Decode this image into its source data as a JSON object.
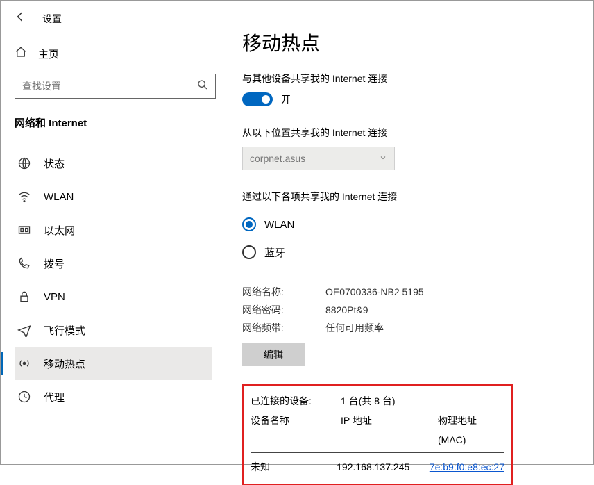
{
  "header": {
    "app_title": "设置"
  },
  "sidebar": {
    "home_label": "主页",
    "search_placeholder": "查找设置",
    "category_title": "网络和 Internet",
    "items": [
      {
        "label": "状态"
      },
      {
        "label": "WLAN"
      },
      {
        "label": "以太网"
      },
      {
        "label": "拨号"
      },
      {
        "label": "VPN"
      },
      {
        "label": "飞行模式"
      },
      {
        "label": "移动热点"
      },
      {
        "label": "代理"
      }
    ]
  },
  "main": {
    "title": "移动热点",
    "share_label": "与其他设备共享我的 Internet 连接",
    "toggle_state": "开",
    "share_from_label": "从以下位置共享我的 Internet 连接",
    "share_from_value": "corpnet.asus",
    "share_over_label": "通过以下各项共享我的 Internet 连接",
    "radio_wlan": "WLAN",
    "radio_bt": "蓝牙",
    "net_name_k": "网络名称:",
    "net_name_v": "OE0700336-NB2 5195",
    "net_pass_k": "网络密码:",
    "net_pass_v": "8820Pt&9",
    "net_band_k": "网络频带:",
    "net_band_v": "任何可用频率",
    "edit_label": "编辑",
    "connected_label": "已连接的设备:",
    "connected_value": "1 台(共 8 台)",
    "col_device": "设备名称",
    "col_ip": "IP 地址",
    "col_mac": "物理地址(MAC)",
    "row_device": "未知",
    "row_ip": "192.168.137.245",
    "row_mac": "7e:b9:f0:e8:ec:27"
  }
}
